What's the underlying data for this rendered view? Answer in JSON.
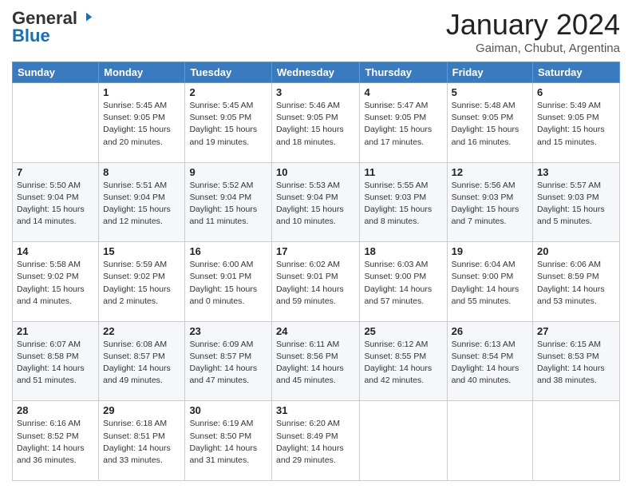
{
  "header": {
    "logo_general": "General",
    "logo_blue": "Blue",
    "month": "January 2024",
    "location": "Gaiman, Chubut, Argentina"
  },
  "days_of_week": [
    "Sunday",
    "Monday",
    "Tuesday",
    "Wednesday",
    "Thursday",
    "Friday",
    "Saturday"
  ],
  "weeks": [
    [
      {
        "day": "",
        "info": ""
      },
      {
        "day": "1",
        "info": "Sunrise: 5:45 AM\nSunset: 9:05 PM\nDaylight: 15 hours\nand 20 minutes."
      },
      {
        "day": "2",
        "info": "Sunrise: 5:45 AM\nSunset: 9:05 PM\nDaylight: 15 hours\nand 19 minutes."
      },
      {
        "day": "3",
        "info": "Sunrise: 5:46 AM\nSunset: 9:05 PM\nDaylight: 15 hours\nand 18 minutes."
      },
      {
        "day": "4",
        "info": "Sunrise: 5:47 AM\nSunset: 9:05 PM\nDaylight: 15 hours\nand 17 minutes."
      },
      {
        "day": "5",
        "info": "Sunrise: 5:48 AM\nSunset: 9:05 PM\nDaylight: 15 hours\nand 16 minutes."
      },
      {
        "day": "6",
        "info": "Sunrise: 5:49 AM\nSunset: 9:05 PM\nDaylight: 15 hours\nand 15 minutes."
      }
    ],
    [
      {
        "day": "7",
        "info": "Sunrise: 5:50 AM\nSunset: 9:04 PM\nDaylight: 15 hours\nand 14 minutes."
      },
      {
        "day": "8",
        "info": "Sunrise: 5:51 AM\nSunset: 9:04 PM\nDaylight: 15 hours\nand 12 minutes."
      },
      {
        "day": "9",
        "info": "Sunrise: 5:52 AM\nSunset: 9:04 PM\nDaylight: 15 hours\nand 11 minutes."
      },
      {
        "day": "10",
        "info": "Sunrise: 5:53 AM\nSunset: 9:04 PM\nDaylight: 15 hours\nand 10 minutes."
      },
      {
        "day": "11",
        "info": "Sunrise: 5:55 AM\nSunset: 9:03 PM\nDaylight: 15 hours\nand 8 minutes."
      },
      {
        "day": "12",
        "info": "Sunrise: 5:56 AM\nSunset: 9:03 PM\nDaylight: 15 hours\nand 7 minutes."
      },
      {
        "day": "13",
        "info": "Sunrise: 5:57 AM\nSunset: 9:03 PM\nDaylight: 15 hours\nand 5 minutes."
      }
    ],
    [
      {
        "day": "14",
        "info": "Sunrise: 5:58 AM\nSunset: 9:02 PM\nDaylight: 15 hours\nand 4 minutes."
      },
      {
        "day": "15",
        "info": "Sunrise: 5:59 AM\nSunset: 9:02 PM\nDaylight: 15 hours\nand 2 minutes."
      },
      {
        "day": "16",
        "info": "Sunrise: 6:00 AM\nSunset: 9:01 PM\nDaylight: 15 hours\nand 0 minutes."
      },
      {
        "day": "17",
        "info": "Sunrise: 6:02 AM\nSunset: 9:01 PM\nDaylight: 14 hours\nand 59 minutes."
      },
      {
        "day": "18",
        "info": "Sunrise: 6:03 AM\nSunset: 9:00 PM\nDaylight: 14 hours\nand 57 minutes."
      },
      {
        "day": "19",
        "info": "Sunrise: 6:04 AM\nSunset: 9:00 PM\nDaylight: 14 hours\nand 55 minutes."
      },
      {
        "day": "20",
        "info": "Sunrise: 6:06 AM\nSunset: 8:59 PM\nDaylight: 14 hours\nand 53 minutes."
      }
    ],
    [
      {
        "day": "21",
        "info": "Sunrise: 6:07 AM\nSunset: 8:58 PM\nDaylight: 14 hours\nand 51 minutes."
      },
      {
        "day": "22",
        "info": "Sunrise: 6:08 AM\nSunset: 8:57 PM\nDaylight: 14 hours\nand 49 minutes."
      },
      {
        "day": "23",
        "info": "Sunrise: 6:09 AM\nSunset: 8:57 PM\nDaylight: 14 hours\nand 47 minutes."
      },
      {
        "day": "24",
        "info": "Sunrise: 6:11 AM\nSunset: 8:56 PM\nDaylight: 14 hours\nand 45 minutes."
      },
      {
        "day": "25",
        "info": "Sunrise: 6:12 AM\nSunset: 8:55 PM\nDaylight: 14 hours\nand 42 minutes."
      },
      {
        "day": "26",
        "info": "Sunrise: 6:13 AM\nSunset: 8:54 PM\nDaylight: 14 hours\nand 40 minutes."
      },
      {
        "day": "27",
        "info": "Sunrise: 6:15 AM\nSunset: 8:53 PM\nDaylight: 14 hours\nand 38 minutes."
      }
    ],
    [
      {
        "day": "28",
        "info": "Sunrise: 6:16 AM\nSunset: 8:52 PM\nDaylight: 14 hours\nand 36 minutes."
      },
      {
        "day": "29",
        "info": "Sunrise: 6:18 AM\nSunset: 8:51 PM\nDaylight: 14 hours\nand 33 minutes."
      },
      {
        "day": "30",
        "info": "Sunrise: 6:19 AM\nSunset: 8:50 PM\nDaylight: 14 hours\nand 31 minutes."
      },
      {
        "day": "31",
        "info": "Sunrise: 6:20 AM\nSunset: 8:49 PM\nDaylight: 14 hours\nand 29 minutes."
      },
      {
        "day": "",
        "info": ""
      },
      {
        "day": "",
        "info": ""
      },
      {
        "day": "",
        "info": ""
      }
    ]
  ]
}
